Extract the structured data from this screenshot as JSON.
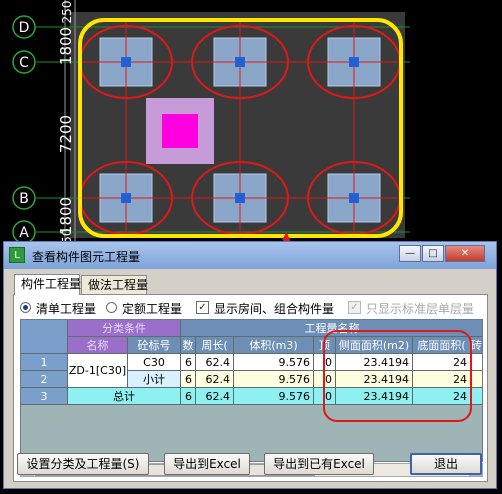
{
  "cad": {
    "axes": [
      {
        "label": "D"
      },
      {
        "label": "C"
      },
      {
        "label": "B"
      },
      {
        "label": "A"
      }
    ],
    "dims": [
      "1800",
      "7200",
      "1800",
      "250",
      "250"
    ],
    "colors": {
      "background": "#000000",
      "slab": "#3a3a3a",
      "outline": "#ffe600",
      "ellipse": "#e01818",
      "column": "#1e62d6",
      "pier_fill": "#8aa6c8",
      "pit_outer": "#c79bd8",
      "pit_inner": "#ff00e0",
      "axis_circle": "#2ea83a"
    }
  },
  "window": {
    "title": "查看构件图元工程量",
    "controls": [
      "minimize-icon",
      "maximize-icon",
      "close-icon"
    ]
  },
  "tabs": [
    "构件工程量",
    "做法工程量"
  ],
  "options": {
    "radio1": "清单工程量",
    "radio2": "定额工程量",
    "check1": "显示房间、组合构件量",
    "check2": "只显示标准层单层量"
  },
  "table": {
    "group_header_left": "分类条件",
    "group_header_right": "工程量名称",
    "headers": [
      "名称",
      "砼标号",
      "数",
      "周长(",
      "体积(m3)",
      "顶",
      "侧面面积(m2)",
      "底面面积(",
      "砖胎"
    ],
    "row_numbers": [
      "1",
      "2",
      "3"
    ],
    "rows": [
      {
        "name": "ZD-1[C30]",
        "grade": "C30",
        "count": "6",
        "perimeter": "62.4",
        "volume": "9.576",
        "top": "0",
        "side_area": "23.4194",
        "bottom_area": "24"
      },
      {
        "name": "",
        "grade": "小计",
        "count": "6",
        "perimeter": "62.4",
        "volume": "9.576",
        "top": "0",
        "side_area": "23.4194",
        "bottom_area": "24"
      },
      {
        "name": "总计",
        "grade": "",
        "count": "6",
        "perimeter": "62.4",
        "volume": "9.576",
        "top": "0",
        "side_area": "23.4194",
        "bottom_area": "24"
      }
    ]
  },
  "buttons": {
    "settings": "设置分类及工程量(S)",
    "export_excel": "导出到Excel",
    "export_existing": "导出到已有Excel",
    "exit": "退出"
  }
}
